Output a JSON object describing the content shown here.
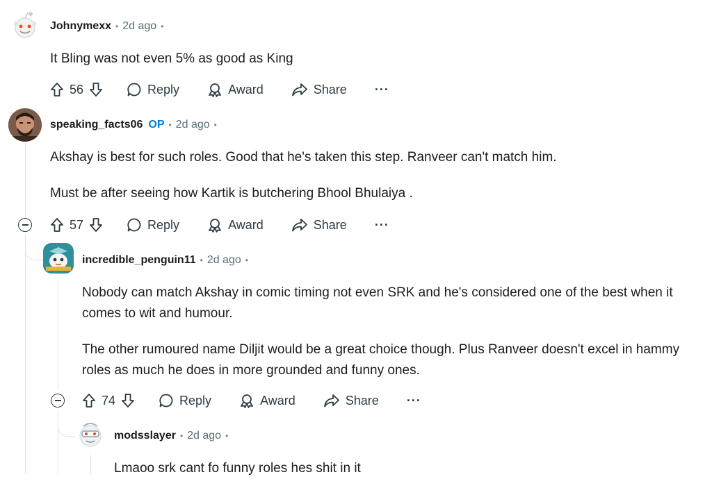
{
  "comments": [
    {
      "username": "Johnymexx",
      "op_badge": "",
      "time": "2d ago",
      "body": [
        "It Bling was not even 5% as good as King"
      ],
      "votes": "56",
      "reply_label": "Reply",
      "award_label": "Award",
      "share_label": "Share",
      "more_label": "···"
    },
    {
      "username": "speaking_facts06",
      "op_badge": "OP",
      "time": "2d ago",
      "body": [
        "Akshay is best for such roles. Good that he's taken this step. Ranveer can't match him.",
        "Must be after seeing how Kartik is butchering Bhool Bhulaiya ."
      ],
      "votes": "57",
      "reply_label": "Reply",
      "award_label": "Award",
      "share_label": "Share",
      "more_label": "···"
    },
    {
      "username": "incredible_penguin11",
      "op_badge": "",
      "time": "2d ago",
      "body": [
        "Nobody can match Akshay in comic timing not even SRK and he's considered one of the best when it comes to wit and humour.",
        "The other rumoured name Diljit would be a great choice though. Plus Ranveer doesn't excel in hammy roles as much he does in more grounded and funny ones."
      ],
      "votes": "74",
      "reply_label": "Reply",
      "award_label": "Award",
      "share_label": "Share",
      "more_label": "···"
    },
    {
      "username": "modsslayer",
      "op_badge": "",
      "time": "2d ago",
      "body": [
        "Lmaoo srk cant fo funny roles hes shit in it"
      ]
    }
  ],
  "separator": "•",
  "icons": {
    "upvote": "upvote-icon",
    "downvote": "downvote-icon",
    "reply": "reply-icon",
    "award": "award-icon",
    "share": "share-icon",
    "collapse": "collapse-icon"
  },
  "colors": {
    "op": "#0079d3",
    "meta": "#576f76",
    "thread": "#dfe3e6"
  }
}
